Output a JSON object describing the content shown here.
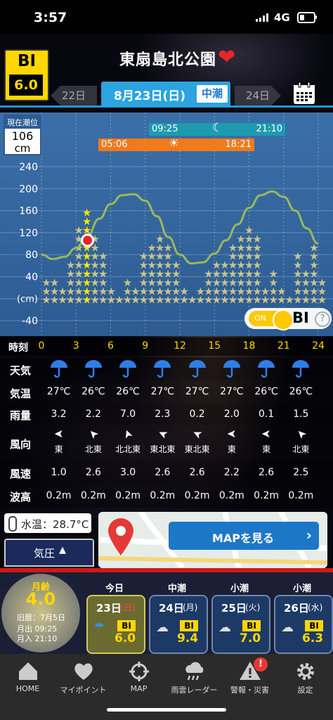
{
  "status": {
    "time": "3:57",
    "network": "4G"
  },
  "header": {
    "bi_label": "BI",
    "bi_value": "6.0",
    "place": "東扇島北公園",
    "favorite": true
  },
  "datenav": {
    "prev": "22日",
    "current": "8月23日(日)",
    "tide_type": "中潮",
    "next": "24日"
  },
  "chart_data": {
    "type": "line",
    "current_tide_label": "現在潮位",
    "current_tide_value": "106",
    "current_tide_unit": "cm",
    "moon_bar": {
      "rise": "09:25",
      "set": "21:10"
    },
    "sun_bar": {
      "rise": "05:06",
      "set": "18:21"
    },
    "y_ticks": [
      "240",
      "200",
      "160",
      "120",
      "80",
      "40",
      "(cm)",
      "-40"
    ],
    "ylim": [
      -50,
      260
    ],
    "tide_curve": {
      "x": [
        0,
        1,
        2,
        3,
        4,
        5,
        6,
        7,
        8,
        9,
        10,
        11,
        12,
        13,
        14,
        15,
        16,
        17,
        18,
        19,
        20,
        21,
        22,
        23,
        24
      ],
      "y": [
        80,
        72,
        76,
        92,
        115,
        145,
        172,
        188,
        190,
        178,
        150,
        112,
        80,
        64,
        66,
        82,
        106,
        135,
        165,
        188,
        195,
        185,
        160,
        128,
        100
      ]
    },
    "current_marker": {
      "x": 4,
      "y": 106
    },
    "star_counts": [
      3,
      3,
      2,
      5,
      9,
      11,
      8,
      6,
      2,
      1,
      3,
      2,
      6,
      7,
      8,
      7,
      5,
      2,
      1,
      2,
      4,
      5,
      5,
      7,
      8,
      9,
      8,
      2,
      4,
      2,
      1,
      6,
      4,
      7,
      3
    ],
    "bi_toggle": {
      "state": "ON",
      "label": "BI"
    },
    "help": "?"
  },
  "timeaxis": {
    "label": "時刻",
    "ticks": [
      "0",
      "3",
      "6",
      "9",
      "12",
      "15",
      "18",
      "21",
      "24"
    ]
  },
  "weather": {
    "rows": [
      {
        "label": "天気",
        "kind": "icon",
        "cells": [
          "umbrella",
          "umbrella",
          "umbrella",
          "umbrella",
          "umbrella",
          "umbrella",
          "umbrella",
          "umbrella"
        ]
      },
      {
        "label": "気温",
        "cells": [
          "27℃",
          "26℃",
          "26℃",
          "27℃",
          "27℃",
          "27℃",
          "26℃",
          "26℃"
        ]
      },
      {
        "label": "雨量",
        "cells": [
          "3.2",
          "2.2",
          "7.0",
          "2.3",
          "0.2",
          "2.0",
          "0.1",
          "1.5"
        ]
      },
      {
        "label": "風向",
        "kind": "wind",
        "cells": [
          "東",
          "北東",
          "北北東",
          "東北東",
          "東北東",
          "東",
          "東",
          "北東"
        ]
      },
      {
        "label": "風速",
        "cells": [
          "1.0",
          "2.6",
          "3.0",
          "2.6",
          "2.6",
          "2.2",
          "2.6",
          "2.5"
        ]
      },
      {
        "label": "波高",
        "cells": [
          "0.2m",
          "0.2m",
          "0.2m",
          "0.2m",
          "0.2m",
          "0.2m",
          "0.2m",
          "0.2m"
        ]
      }
    ]
  },
  "water_temp": "水温：28.7°C",
  "pressure": "気圧",
  "map_button": "MAPを見る",
  "moon": {
    "label": "月齢",
    "age": "4.0",
    "lunar_date": "旧暦：7月5日",
    "rise": "月出 09:25",
    "set": "月入 21:10"
  },
  "forecast": [
    {
      "head": "今日",
      "date": "23日",
      "dow": "(日)",
      "bi": "6.0",
      "selected": true
    },
    {
      "head": "中潮",
      "date": "24日",
      "dow": "(月)",
      "bi": "9.4"
    },
    {
      "head": "小潮",
      "date": "25日",
      "dow": "(火)",
      "bi": "7.0"
    },
    {
      "head": "小潮",
      "date": "26日",
      "dow": "(水)",
      "bi": "6.3"
    }
  ],
  "tabs": [
    {
      "label": "HOME",
      "icon": "home-icon"
    },
    {
      "label": "マイポイント",
      "icon": "heart-icon"
    },
    {
      "label": "MAP",
      "icon": "crosshair-icon"
    },
    {
      "label": "雨雲レーダー",
      "icon": "rain-cloud-icon"
    },
    {
      "label": "警報・災害",
      "icon": "warning-icon",
      "badge": "!"
    },
    {
      "label": "設定",
      "icon": "gear-icon"
    }
  ]
}
